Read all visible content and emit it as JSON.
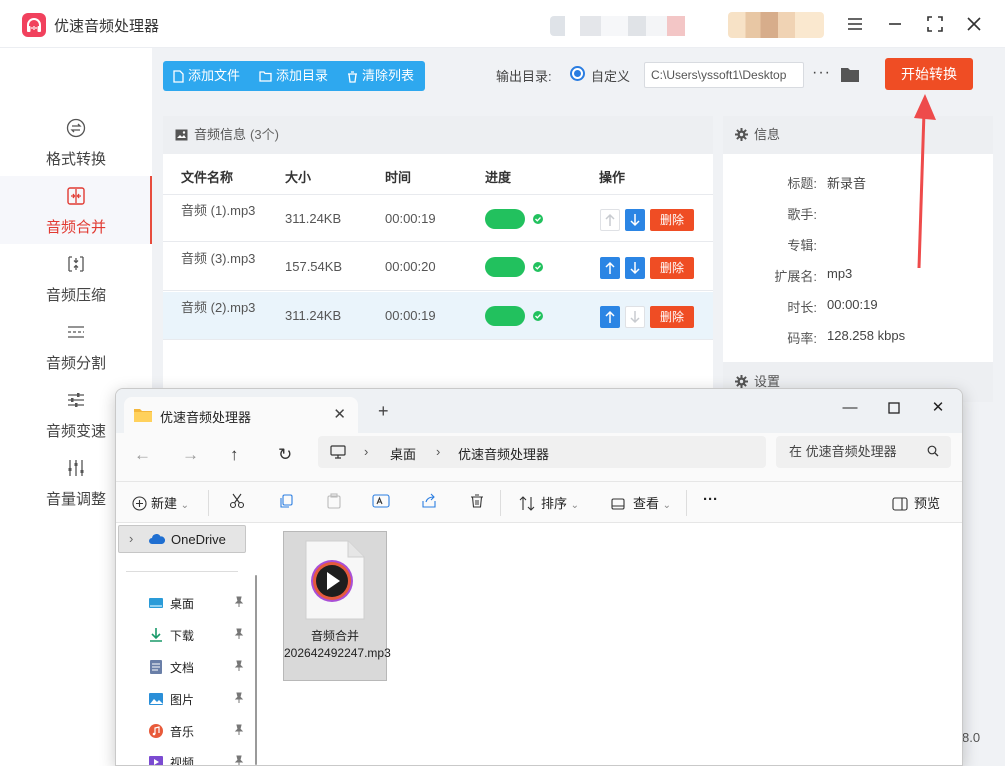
{
  "app": {
    "title": "优速音频处理器",
    "version": "8.0"
  },
  "sidebar": {
    "items": [
      {
        "label": "格式转换"
      },
      {
        "label": "音频合并"
      },
      {
        "label": "音频压缩"
      },
      {
        "label": "音频分割"
      },
      {
        "label": "音频变速"
      },
      {
        "label": "音量调整"
      }
    ]
  },
  "toolbar": {
    "add_file": "添加文件",
    "add_dir": "添加目录",
    "clear_list": "清除列表",
    "output_label": "输出目录:",
    "custom_label": "自定义",
    "path_value": "C:\\Users\\yssoft1\\Desktop",
    "more": "···",
    "start": "开始转换"
  },
  "files_panel": {
    "title": "音频信息",
    "count": "(3个)",
    "headers": [
      "文件名称",
      "大小",
      "时间",
      "进度",
      "操作"
    ],
    "rows": [
      {
        "name": "音频 (1).mp3",
        "size": "311.24KB",
        "time": "00:00:19",
        "delete": "删除"
      },
      {
        "name": "音频 (3).mp3",
        "size": "157.54KB",
        "time": "00:00:20",
        "delete": "删除"
      },
      {
        "name": "音频 (2).mp3",
        "size": "311.24KB",
        "time": "00:00:19",
        "delete": "删除"
      }
    ]
  },
  "info_panel": {
    "title": "信息",
    "fields": [
      {
        "key": "标题:",
        "value": "新录音"
      },
      {
        "key": "歌手:",
        "value": ""
      },
      {
        "key": "专辑:",
        "value": ""
      },
      {
        "key": "扩展名:",
        "value": "mp3"
      },
      {
        "key": "时长:",
        "value": "00:00:19"
      },
      {
        "key": "码率:",
        "value": "128.258 kbps"
      }
    ]
  },
  "settings_panel": {
    "title": "设置"
  },
  "explorer": {
    "tab_title": "优速音频处理器",
    "breadcrumb": [
      "桌面",
      "优速音频处理器"
    ],
    "search_placeholder": "在 优速音频处理器",
    "commands": {
      "new": "新建",
      "sort": "排序",
      "view": "查看",
      "more": "···",
      "preview": "预览"
    },
    "nav": {
      "onedrive": "OneDrive",
      "items": [
        {
          "label": "桌面"
        },
        {
          "label": "下载"
        },
        {
          "label": "文档"
        },
        {
          "label": "图片"
        },
        {
          "label": "音乐"
        },
        {
          "label": "视频"
        }
      ]
    },
    "file": {
      "name": "音频合并202642492247.mp3"
    }
  },
  "colors": {
    "accent_blue": "#2ea8ef",
    "start_red": "#ef4d24",
    "progress_green": "#22c15e",
    "active_nav_red": "#e13a32"
  }
}
